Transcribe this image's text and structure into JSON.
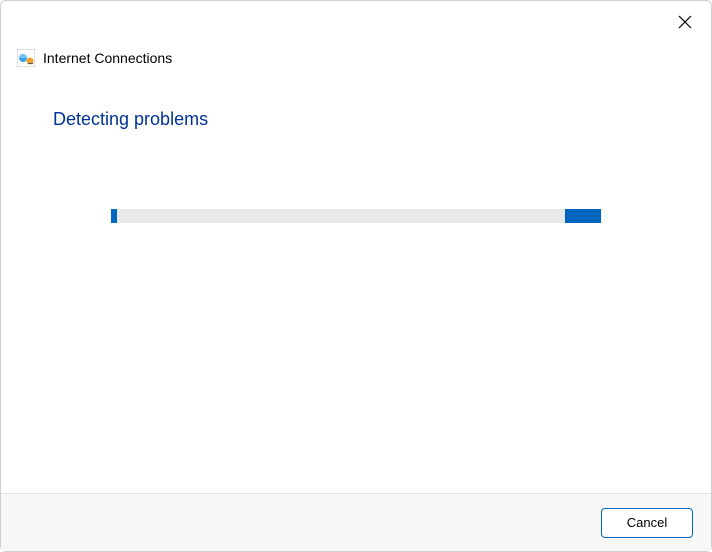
{
  "window": {
    "title": "Internet Connections",
    "close_icon": "close"
  },
  "content": {
    "heading": "Detecting problems"
  },
  "progress": {
    "accent_color": "#0067c0",
    "track_color": "#e8e8e8"
  },
  "footer": {
    "cancel_label": "Cancel"
  }
}
